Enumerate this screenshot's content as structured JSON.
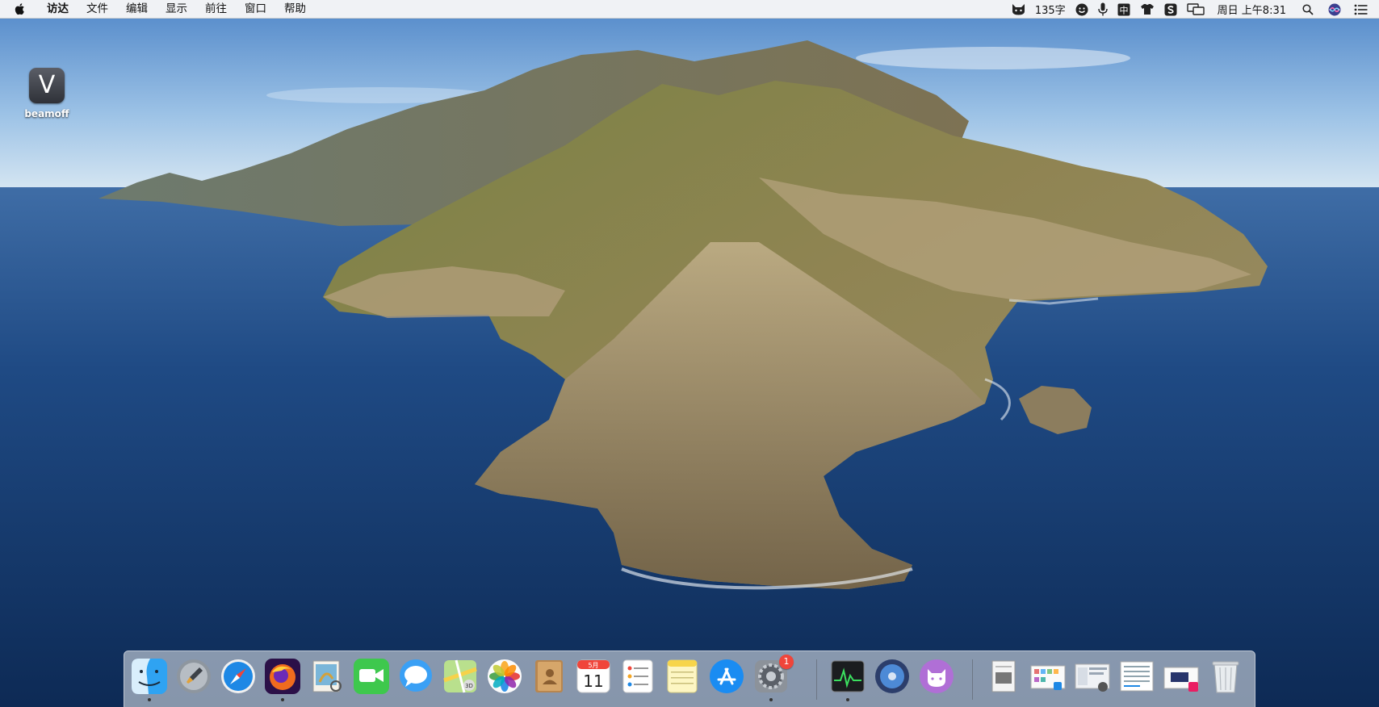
{
  "menubar": {
    "app_name": "访达",
    "items": [
      "文件",
      "编辑",
      "显示",
      "前往",
      "窗口",
      "帮助"
    ],
    "char_count": "135字",
    "input_method": "中",
    "clock": "周日 上午8:31"
  },
  "desktop": {
    "icons": [
      {
        "label": "beamoff",
        "glyph": "V",
        "icon": "beamoff-app-icon"
      }
    ]
  },
  "dock": {
    "apps": [
      {
        "icon": "finder-icon",
        "running": true
      },
      {
        "icon": "launchpad-icon",
        "running": false
      },
      {
        "icon": "safari-icon",
        "running": false
      },
      {
        "icon": "firefox-icon",
        "running": true
      },
      {
        "icon": "preview-icon",
        "running": false
      },
      {
        "icon": "facetime-icon",
        "running": false
      },
      {
        "icon": "messages-icon",
        "running": false
      },
      {
        "icon": "maps-icon",
        "running": false
      },
      {
        "icon": "photos-icon",
        "running": false
      },
      {
        "icon": "contacts-icon",
        "running": false
      },
      {
        "icon": "calendar-icon",
        "running": false,
        "month": "5月",
        "day": "11"
      },
      {
        "icon": "reminders-icon",
        "running": false
      },
      {
        "icon": "notes-icon",
        "running": false
      },
      {
        "icon": "app-store-icon",
        "running": false
      },
      {
        "icon": "system-preferences-icon",
        "running": true,
        "badge": "1"
      },
      {
        "icon": "activity-monitor-icon",
        "running": true
      },
      {
        "icon": "disk-utility-icon",
        "running": false
      },
      {
        "icon": "cat-app-icon",
        "running": false
      }
    ],
    "stacks": [
      {
        "icon": "document-stack-icon"
      },
      {
        "icon": "screenshot-stack-icon-1"
      },
      {
        "icon": "screenshot-stack-icon-2"
      },
      {
        "icon": "screenshot-stack-icon-3"
      },
      {
        "icon": "screenshot-stack-icon-4"
      },
      {
        "icon": "trash-icon"
      }
    ]
  },
  "colors": {
    "sky_top": "#4f86c8",
    "sky_bottom": "#cfe1f0",
    "ocean_far": "#3d6aa4",
    "ocean_near": "#0f2c5a",
    "island_green": "#6b7a3a",
    "island_rock": "#a89572",
    "badge": "#f0453a"
  }
}
